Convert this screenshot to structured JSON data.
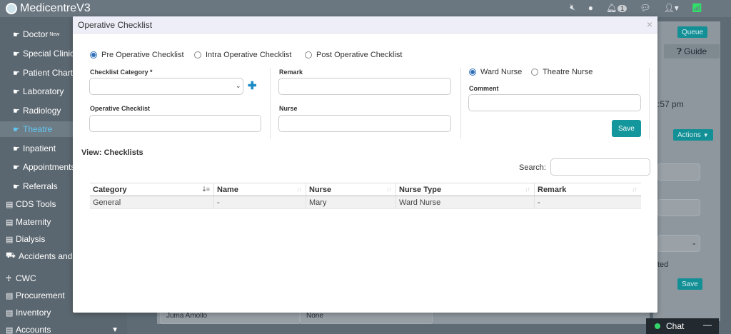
{
  "app": {
    "brand": "MedicentreV3"
  },
  "topbar": {
    "notification_count": "1"
  },
  "sidebar": {
    "items": [
      {
        "label": "Doctor",
        "badge": "New"
      },
      {
        "label": "Special Clinics"
      },
      {
        "label": "Patient Chart"
      },
      {
        "label": "Laboratory"
      },
      {
        "label": "Radiology"
      },
      {
        "label": "Theatre"
      },
      {
        "label": "Inpatient"
      },
      {
        "label": "Appointments"
      },
      {
        "label": "Referrals"
      },
      {
        "label": "CDS Tools"
      },
      {
        "label": "Maternity"
      },
      {
        "label": "Dialysis"
      },
      {
        "label": "Accidents and"
      },
      {
        "label": "CWC"
      },
      {
        "label": "Procurement"
      },
      {
        "label": "Inventory"
      },
      {
        "label": "Accounts"
      }
    ]
  },
  "background": {
    "queue_label": "Queue",
    "guide_label": "Guide",
    "time_text": ":57 pm",
    "actions_label": "Actions",
    "ted_text": "ted",
    "save_label": "Save",
    "bottom_left_value": "Juma Amollo",
    "bottom_mid_value": "None"
  },
  "modal": {
    "title": "Operative Checklist",
    "close_symbol": "×",
    "tabs": [
      {
        "label": "Pre Operative Checklist",
        "checked": true
      },
      {
        "label": "Intra Operative Checklist",
        "checked": false
      },
      {
        "label": "Post Operative Checklist",
        "checked": false
      }
    ],
    "form": {
      "checklist_category_label": "Checklist Category",
      "required_mark": "*",
      "checklist_category_value": "",
      "operative_checklist_label": "Operative Checklist",
      "operative_checklist_value": "",
      "remark_label": "Remark",
      "remark_value": "",
      "nurse_label": "Nurse",
      "nurse_value": "",
      "nurse_type_options": [
        {
          "label": "Ward Nurse",
          "checked": true
        },
        {
          "label": "Theatre Nurse",
          "checked": false
        }
      ],
      "comment_label": "Comment",
      "comment_value": "",
      "save_label": "Save"
    },
    "view": {
      "title": "View: Checklists",
      "search_label": "Search:",
      "search_value": "",
      "columns": [
        "Category",
        "Name",
        "Nurse",
        "Nurse Type",
        "Remark"
      ],
      "rows": [
        [
          "General",
          "-",
          "Mary",
          "Ward Nurse",
          "-"
        ]
      ]
    }
  },
  "chat": {
    "label": "Chat",
    "minimize": "—"
  }
}
